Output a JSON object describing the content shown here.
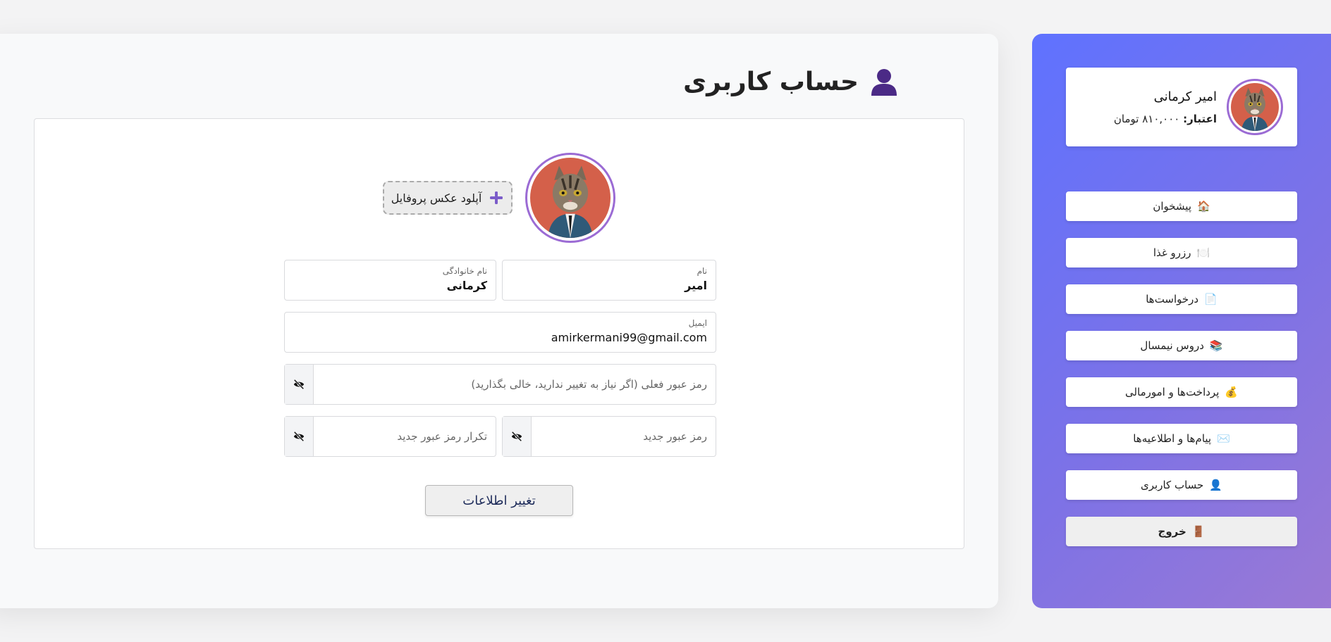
{
  "main": {
    "title": "حساب کاربری",
    "upload_label": "آپلود عکس پروفایل",
    "first_name": {
      "label": "نام",
      "value": "امیر"
    },
    "last_name": {
      "label": "نام خانوادگی",
      "value": "کرمانی"
    },
    "email": {
      "label": "ایمیل",
      "value": "amirkermani99@gmail.com"
    },
    "current_password_placeholder": "رمز عبور فعلی (اگر نیاز به تغییر ندارید، خالی بگذارید)",
    "new_password_placeholder": "رمز عبور جدید",
    "confirm_password_placeholder": "تکرار رمز عبور جدید",
    "submit_label": "تغییر اطلاعات"
  },
  "sidebar": {
    "profile": {
      "name": "امیر کرمانی",
      "credit_label": "اعتبار:",
      "credit_value": "۸۱۰,۰۰۰ تومان"
    },
    "items": [
      {
        "icon": "🏠",
        "icon_name": "home-icon",
        "label": "پیشخوان"
      },
      {
        "icon": "🍽️",
        "icon_name": "plate-icon",
        "label": "رزرو غذا"
      },
      {
        "icon": "📄",
        "icon_name": "document-icon",
        "label": "درخواست‌ها"
      },
      {
        "icon": "📚",
        "icon_name": "books-icon",
        "label": "دروس نیمسال"
      },
      {
        "icon": "💰",
        "icon_name": "money-bag-icon",
        "label": "پرداخت‌ها و امورمالی"
      },
      {
        "icon": "✉️",
        "icon_name": "envelope-icon",
        "label": "پیام‌ها و اطلاعیه‌ها"
      },
      {
        "icon": "👤",
        "icon_name": "user-icon",
        "label": "حساب کاربری"
      },
      {
        "icon": "🚪",
        "icon_name": "door-icon",
        "label": "خروج"
      }
    ]
  },
  "colors": {
    "accent": "#9b6bd4",
    "sidebar_gradient_start": "#5f72ff",
    "sidebar_gradient_end": "#9b79d4",
    "title_icon": "#4b2a86"
  }
}
